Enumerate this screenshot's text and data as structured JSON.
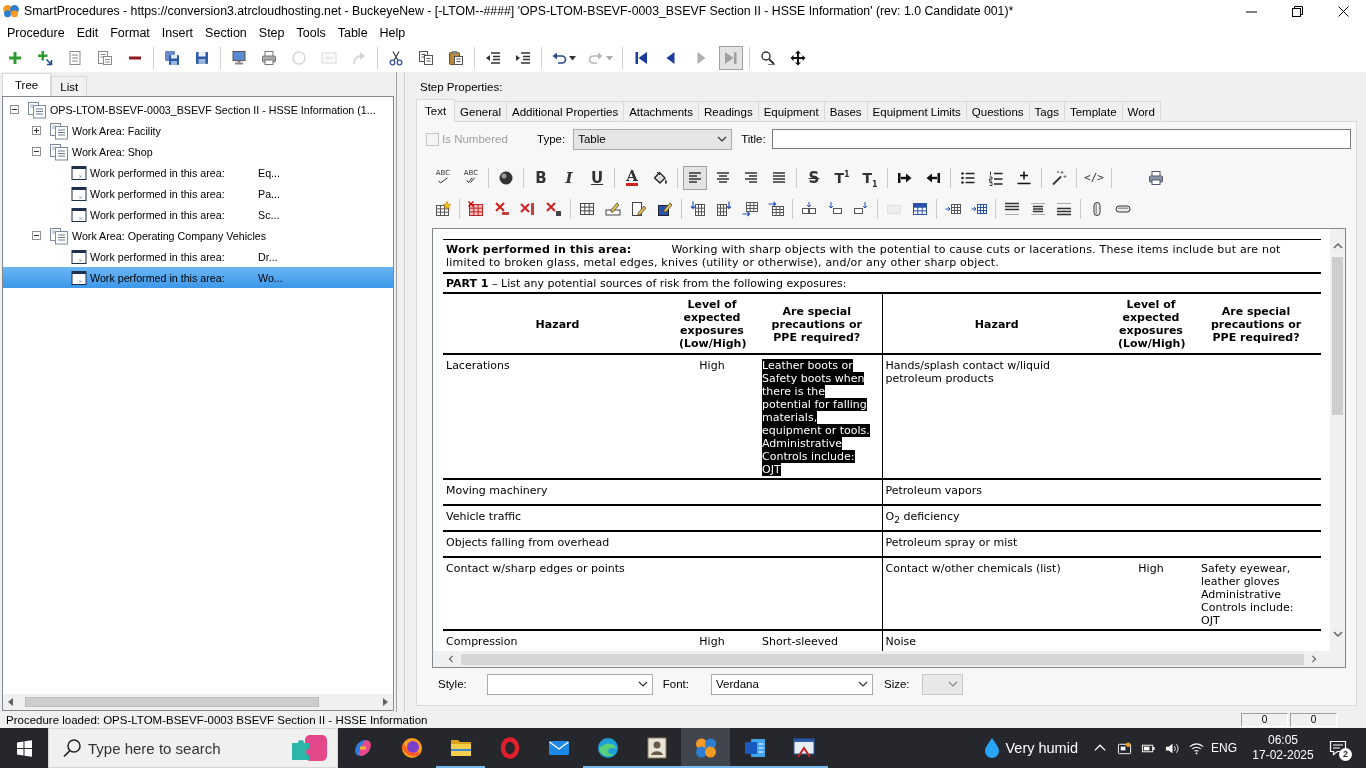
{
  "window": {
    "title": "SmartProcedures - https://conversion3.atrcloudhosting.net - BuckeyeNew - [-LTOM--####] 'OPS-LTOM-BSEVF-0003_BSEVF Section II - HSSE Information' (rev: 1.0 Candidate 001)*"
  },
  "menu": [
    "Procedure",
    "Edit",
    "Format",
    "Insert",
    "Section",
    "Step",
    "Tools",
    "Table",
    "Help"
  ],
  "toolbar": {
    "groups": [
      {
        "buttons": [
          {
            "kind": "add",
            "disabled": false
          },
          {
            "kind": "add-child",
            "disabled": false
          },
          {
            "kind": "list",
            "disabled": false
          },
          {
            "kind": "list-alt",
            "disabled": false
          },
          {
            "kind": "remove",
            "disabled": false
          }
        ]
      },
      {
        "buttons": [
          {
            "kind": "save-all",
            "disabled": false
          },
          {
            "kind": "save",
            "disabled": false
          }
        ]
      },
      {
        "buttons": [
          {
            "kind": "computer",
            "disabled": false
          },
          {
            "kind": "print",
            "disabled": false
          },
          {
            "kind": "circle",
            "disabled": true
          },
          {
            "kind": "window",
            "disabled": true
          },
          {
            "kind": "forward",
            "disabled": true
          }
        ]
      },
      {
        "buttons": [
          {
            "kind": "cut",
            "disabled": false
          },
          {
            "kind": "copy",
            "disabled": false
          },
          {
            "kind": "paste",
            "disabled": false
          }
        ]
      },
      {
        "buttons": [
          {
            "kind": "outdent",
            "disabled": false
          },
          {
            "kind": "indent",
            "disabled": false
          }
        ]
      },
      {
        "buttons": [
          {
            "kind": "undo",
            "disabled": false
          },
          {
            "kind": "redo",
            "disabled": true
          }
        ]
      },
      {
        "buttons": [
          {
            "kind": "first",
            "disabled": false,
            "pressed": false
          },
          {
            "kind": "previous",
            "disabled": false,
            "pressed": false
          },
          {
            "kind": "next",
            "disabled": true,
            "pressed": false
          },
          {
            "kind": "last",
            "disabled": true,
            "pressed": true
          }
        ]
      },
      {
        "buttons": [
          {
            "kind": "find",
            "disabled": false
          },
          {
            "kind": "move",
            "disabled": false
          }
        ]
      }
    ]
  },
  "tree": {
    "tabs": [
      {
        "label": "Tree",
        "selected": true
      },
      {
        "label": "List",
        "selected": false
      }
    ],
    "items": [
      {
        "kind": "procedure",
        "label": "OPS-LTOM-BSEVF-0003_BSEVF Section II - HSSE Information (1...",
        "expanded": true,
        "selected": false,
        "children": [
          {
            "kind": "section",
            "label": "Work Area: Facility",
            "expanded": false,
            "selected": false
          },
          {
            "kind": "section",
            "label": "Work Area: Shop",
            "expanded": true,
            "selected": false,
            "children": [
              {
                "kind": "step",
                "label": "Work performed in this area:",
                "detail": "Eq...",
                "selected": false
              },
              {
                "kind": "step",
                "label": "Work performed in this area:",
                "detail": "Pa...",
                "selected": false
              },
              {
                "kind": "step",
                "label": "Work performed in this area:",
                "detail": "Sc...",
                "selected": false
              }
            ]
          },
          {
            "kind": "section",
            "label": "Work Area: Operating Company Vehicles",
            "expanded": true,
            "selected": false,
            "children": [
              {
                "kind": "step",
                "label": "Work performed in this area:",
                "detail": "Dr...",
                "selected": false
              },
              {
                "kind": "step",
                "label": "Work performed in this area:",
                "detail": "Wo...",
                "selected": true
              }
            ]
          }
        ]
      }
    ]
  },
  "step_properties": {
    "label": "Step Properties:",
    "tabs": [
      {
        "label": "Text",
        "selected": true
      },
      {
        "label": "General",
        "selected": false
      },
      {
        "label": "Additional Properties",
        "selected": false
      },
      {
        "label": "Attachments",
        "selected": false
      },
      {
        "label": "Readings",
        "selected": false
      },
      {
        "label": "Equipment",
        "selected": false
      },
      {
        "label": "Bases",
        "selected": false
      },
      {
        "label": "Equipment Limits",
        "selected": false
      },
      {
        "label": "Questions",
        "selected": false
      },
      {
        "label": "Tags",
        "selected": false
      },
      {
        "label": "Template",
        "selected": false
      },
      {
        "label": "Word",
        "selected": false
      }
    ],
    "is_numbered": {
      "label": "Is Numbered",
      "checked": false,
      "disabled": true
    },
    "type": {
      "label": "Type:",
      "value": "Table"
    },
    "title": {
      "label": "Title:"
    },
    "format_toolbar": {
      "rows": [
        {
          "groups": [
            {
              "buttons": [
                {
                  "kind": "spellcheck",
                  "glyph": "ABC",
                  "disabled": false
                },
                {
                  "kind": "spellcheck-auto",
                  "glyph": "ABC",
                  "disabled": false
                }
              ]
            },
            {
              "buttons": [
                {
                  "kind": "color-ball",
                  "disabled": false
                }
              ]
            },
            {
              "buttons": [
                {
                  "kind": "bold",
                  "glyph": "B",
                  "disabled": false
                },
                {
                  "kind": "italic",
                  "glyph": "I",
                  "disabled": false
                },
                {
                  "kind": "underline",
                  "glyph": "U",
                  "disabled": false
                }
              ]
            },
            {
              "buttons": [
                {
                  "kind": "font-color",
                  "glyph": "A",
                  "disabled": false
                },
                {
                  "kind": "fill-color",
                  "disabled": false
                }
              ]
            },
            {
              "buttons": [
                {
                  "kind": "align-left",
                  "disabled": false,
                  "pressed": true
                },
                {
                  "kind": "align-center",
                  "disabled": false,
                  "pressed": false
                },
                {
                  "kind": "align-right",
                  "disabled": false,
                  "pressed": false
                },
                {
                  "kind": "justify",
                  "disabled": false,
                  "pressed": false
                }
              ]
            },
            {
              "buttons": [
                {
                  "kind": "strike",
                  "glyph": "S",
                  "disabled": false
                },
                {
                  "kind": "superscript",
                  "glyph": "T$^{1}$",
                  "disabled": false
                },
                {
                  "kind": "subscript",
                  "glyph": "T$_{1}$",
                  "disabled": false
                }
              ]
            },
            {
              "buttons": [
                {
                  "kind": "indent-in",
                  "disabled": false
                },
                {
                  "kind": "indent-out",
                  "disabled": false
                }
              ]
            },
            {
              "buttons": [
                {
                  "kind": "bullets",
                  "disabled": false
                },
                {
                  "kind": "numbering",
                  "disabled": false
                },
                {
                  "kind": "rule",
                  "disabled": false
                }
              ]
            },
            {
              "buttons": [
                {
                  "kind": "wand",
                  "disabled": false
                }
              ]
            },
            {
              "buttons": [
                {
                  "kind": "code",
                  "glyph": "</>",
                  "disabled": false
                }
              ]
            },
            {
              "buttons": [
                {
                  "kind": "print",
                  "disabled": false
                }
              ]
            }
          ]
        },
        {
          "groups": [
            {
              "buttons": [
                {
                  "kind": "table-insert",
                  "disabled": false
                }
              ]
            },
            {
              "buttons": [
                {
                  "kind": "table-delete",
                  "disabled": false
                },
                {
                  "kind": "row-delete",
                  "disabled": false
                },
                {
                  "kind": "column-delete",
                  "disabled": false
                },
                {
                  "kind": "cell-delete",
                  "disabled": false
                }
              ]
            },
            {
              "buttons": [
                {
                  "kind": "table",
                  "disabled": false
                },
                {
                  "kind": "cell-edit",
                  "disabled": false
                },
                {
                  "kind": "doc-edit",
                  "disabled": false
                },
                {
                  "kind": "block-edit",
                  "disabled": false
                }
              ]
            },
            {
              "buttons": [
                {
                  "kind": "col-left",
                  "disabled": false
                },
                {
                  "kind": "col-right",
                  "disabled": false
                },
                {
                  "kind": "row-above",
                  "disabled": false
                },
                {
                  "kind": "row-below",
                  "disabled": false
                }
              ]
            },
            {
              "buttons": [
                {
                  "kind": "cell-insert",
                  "disabled": false
                },
                {
                  "kind": "cell-insert-left",
                  "disabled": false
                },
                {
                  "kind": "cell-insert-right",
                  "disabled": false
                }
              ]
            },
            {
              "buttons": [
                {
                  "kind": "split",
                  "disabled": true
                },
                {
                  "kind": "merge",
                  "disabled": false
                }
              ]
            },
            {
              "buttons": [
                {
                  "kind": "insert-before",
                  "disabled": false
                },
                {
                  "kind": "insert-after",
                  "disabled": false
                }
              ]
            },
            {
              "buttons": [
                {
                  "kind": "valign-top",
                  "disabled": false
                },
                {
                  "kind": "valign-middle",
                  "disabled": false
                },
                {
                  "kind": "valign-bottom",
                  "disabled": false
                }
              ]
            },
            {
              "buttons": [
                {
                  "kind": "cylinder",
                  "disabled": false
                },
                {
                  "kind": "pill",
                  "disabled": false
                }
              ]
            }
          ]
        }
      ]
    },
    "document": {
      "description": {
        "label": "Work performed in this area:",
        "text": "Working with sharp objects with the potential to cause cuts or lacerations. These items include but are not limited to broken glass, metal edges, knives (utility or otherwise), and/or any other sharp object."
      },
      "instruction": "**PART 1** – List any potential sources of risk from the following exposures:",
      "columns": [
        "Hazard",
        "Level of expected exposures (Low/High)",
        "Are special precautions or PPE required?",
        "Hazard",
        "Level of expected exposures (Low/High)",
        "Are special precautions or PPE required?"
      ],
      "rows": [
        {
          "cells": [
            {
              "text": "Lacerations",
              "selected": false
            },
            {
              "text": "High",
              "selected": false
            },
            {
              "text": "Leather boots or Safety boots when there is the potential for falling materials, equipment or tools. Administrative Controls include: OJT",
              "selected": true
            },
            {
              "text": "Hands/splash contact w/liquid petroleum products",
              "selected": false
            },
            null,
            null
          ]
        },
        {
          "cells": [
            {
              "text": "Moving machinery",
              "selected": false
            },
            null,
            null,
            {
              "text": "Petroleum vapors",
              "selected": false
            },
            null,
            null
          ]
        },
        {
          "cells": [
            {
              "text": "Vehicle traffic",
              "selected": false
            },
            null,
            null,
            {
              "text": "O$_{2}$ deficiency",
              "selected": false
            },
            null,
            null
          ]
        },
        {
          "cells": [
            {
              "text": "Objects falling from overhead",
              "selected": false
            },
            null,
            null,
            {
              "text": "Petroleum spray or mist",
              "selected": false
            },
            null,
            null
          ]
        },
        {
          "cells": [
            {
              "text": "Contact w/sharp edges or points",
              "selected": false
            },
            null,
            null,
            {
              "text": "Contact w/other chemicals (list)",
              "selected": false
            },
            {
              "text": "High",
              "selected": false
            },
            {
              "text": "Safety eyewear, leather gloves Administrative Controls include: OJT",
              "selected": false
            }
          ]
        },
        {
          "cells": [
            {
              "text": "Compression",
              "selected": false
            },
            {
              "text": "High",
              "selected": false
            },
            {
              "text": "Short-sleeved",
              "selected": false
            },
            {
              "text": "Noise",
              "selected": false
            },
            null,
            null
          ]
        }
      ]
    },
    "style": {
      "label": "Style:"
    },
    "font": {
      "label": "Font:",
      "value": "Verdana"
    },
    "size": {
      "label": "Size:",
      "disabled": true
    }
  },
  "status_bar": {
    "text": "Procedure loaded: OPS-LTOM-BSEVF-0003 BSEVF Section II - HSSE Information",
    "panels": [
      "0",
      "0"
    ]
  },
  "taskbar": {
    "search": {
      "placeholder": "Type here to search"
    },
    "apps": [
      {
        "kind": "swirl",
        "running": false,
        "selected": false
      },
      {
        "kind": "globe",
        "running": false,
        "selected": false
      },
      {
        "kind": "folder",
        "running": true,
        "selected": false
      },
      {
        "kind": "ring",
        "running": false,
        "selected": false
      },
      {
        "kind": "envelope",
        "running": false,
        "selected": false
      },
      {
        "kind": "wave",
        "running": true,
        "selected": false
      },
      {
        "kind": "portrait",
        "running": true,
        "selected": false
      },
      {
        "kind": "logo",
        "running": true,
        "selected": true
      },
      {
        "kind": "document",
        "running": true,
        "selected": false
      },
      {
        "kind": "tool",
        "running": true,
        "selected": false
      }
    ],
    "weather": "Very humid",
    "language": "ENG",
    "time": "06:05",
    "date": "17-02-2025",
    "notifications": "2"
  }
}
